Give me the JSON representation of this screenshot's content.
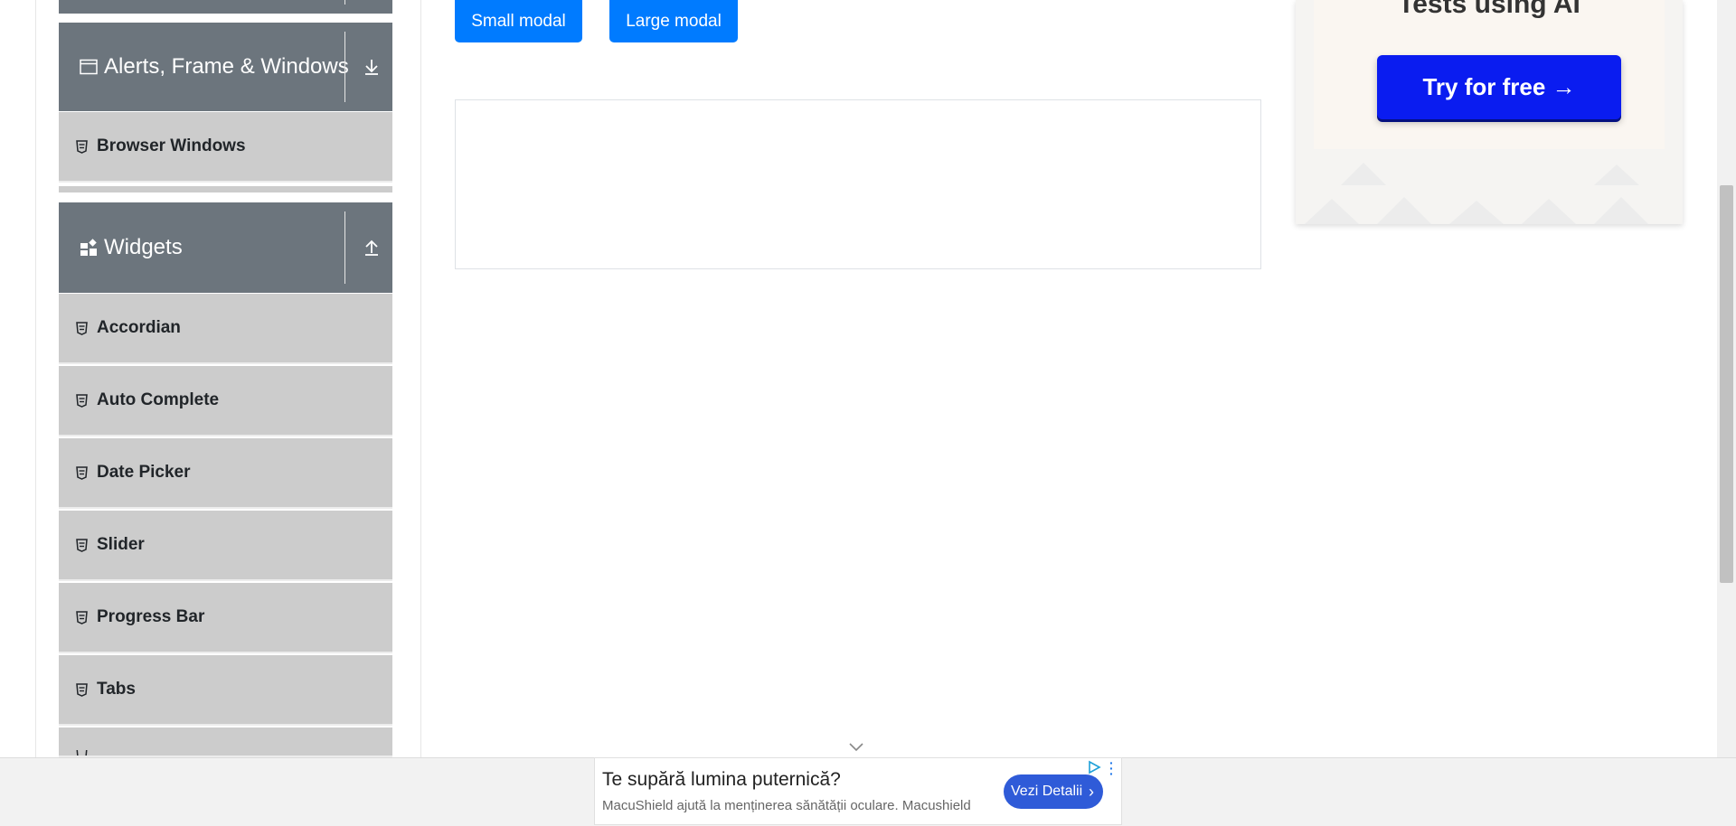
{
  "sidebar": {
    "groups": [
      {
        "title": "Alerts, Frame & Windows",
        "icon": "window-icon",
        "toggle_icon": "download-arrow-icon",
        "items": [
          {
            "label": "Browser Windows"
          }
        ]
      },
      {
        "title": "Widgets",
        "icon": "widgets-icon",
        "toggle_icon": "upload-arrow-icon",
        "items": [
          {
            "label": "Accordian"
          },
          {
            "label": "Auto Complete"
          },
          {
            "label": "Date Picker"
          },
          {
            "label": "Slider"
          },
          {
            "label": "Progress Bar"
          },
          {
            "label": "Tabs"
          }
        ]
      }
    ]
  },
  "main": {
    "buttons": {
      "small_modal": "Small modal",
      "large_modal": "Large modal"
    }
  },
  "ad_card": {
    "tagline": "Tests using AI",
    "cta": "Try for free →"
  },
  "bottom_ad": {
    "headline": "Te supără lumina puternică?",
    "subtext": "MacuShield ajută la menținerea sănătății oculare. Macushield",
    "cta": "Vezi Detalii"
  },
  "colors": {
    "accent": "#007bff",
    "sidebar_header": "#6c757d",
    "sidebar_item": "#cccccc",
    "ad_button": "#0a1cf0"
  }
}
